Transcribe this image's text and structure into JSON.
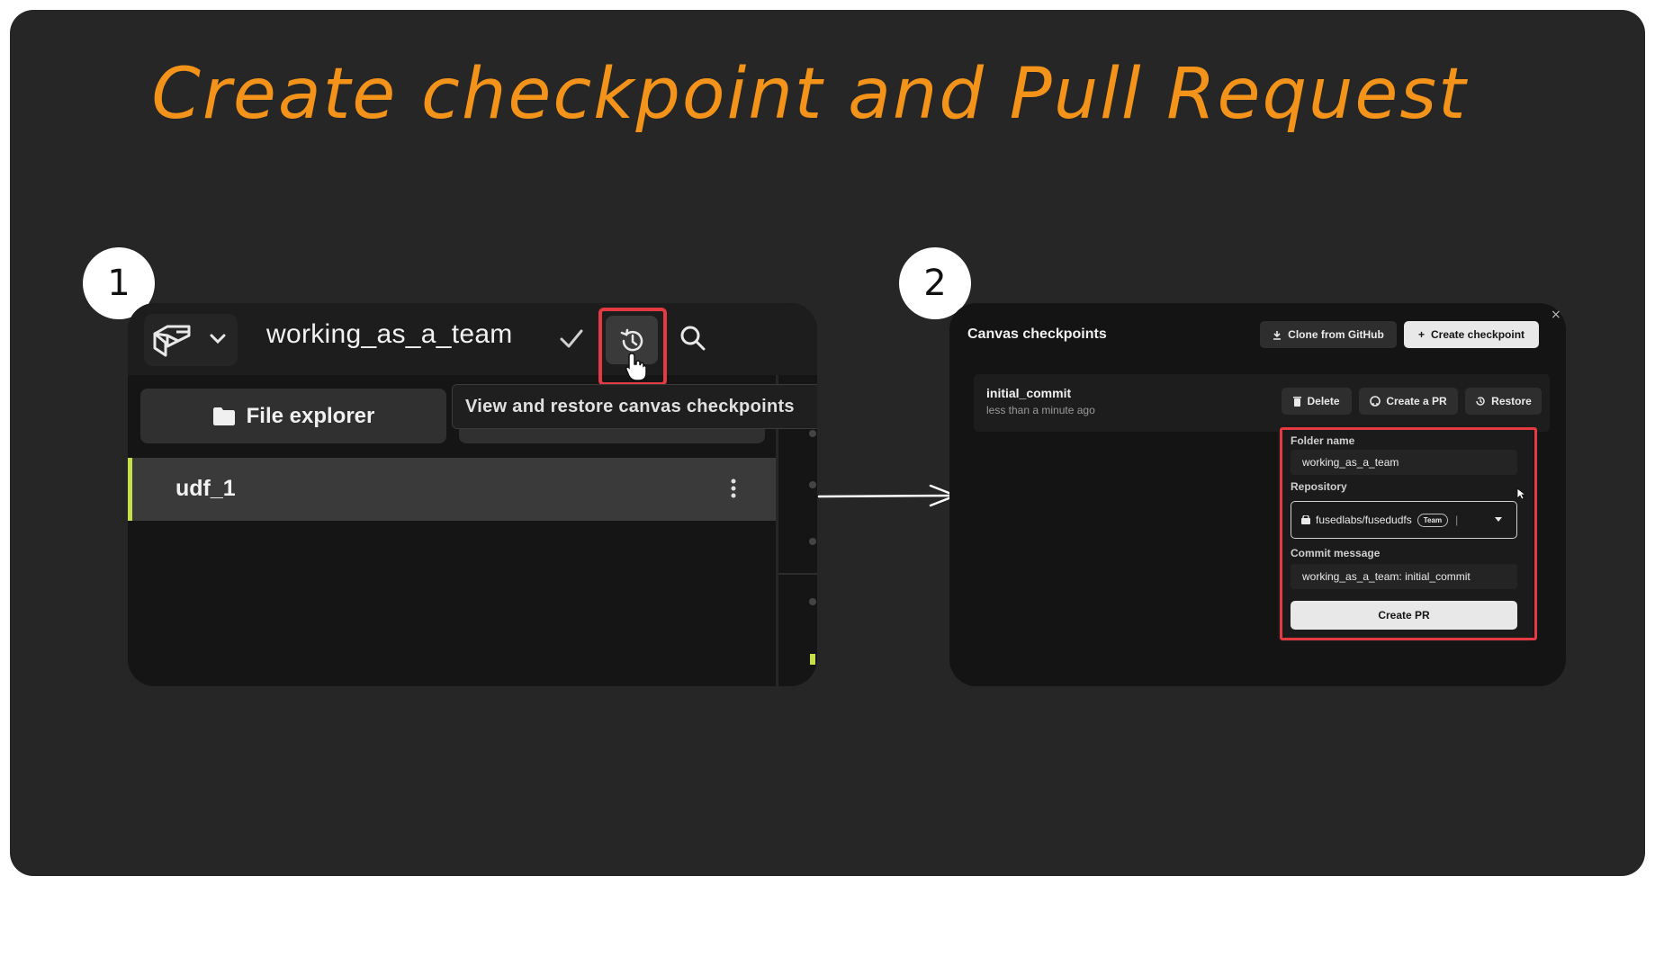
{
  "headline": "Create checkpoint and Pull Request",
  "steps": {
    "one": "1",
    "two": "2"
  },
  "panel1": {
    "canvas_title": "working_as_a_team",
    "file_explorer_label": "File explorer",
    "tooltip": "View and restore canvas checkpoints",
    "udf_name": "udf_1",
    "icons": [
      "fused-logo-icon",
      "chevron-down-icon",
      "check-icon",
      "history-icon",
      "pointer-cursor-icon",
      "search-icon",
      "folder-icon",
      "kebab-menu-icon"
    ]
  },
  "panel2": {
    "title": "Canvas checkpoints",
    "clone_label": "Clone from GitHub",
    "create_checkpoint_label": "Create checkpoint",
    "close": "×",
    "checkpoint": {
      "name": "initial_commit",
      "time": "less than a minute ago",
      "delete_label": "Delete",
      "create_pr_label": "Create a PR",
      "restore_label": "Restore"
    },
    "pr_form": {
      "folder_label": "Folder name",
      "folder_value": "working_as_a_team",
      "repo_label": "Repository",
      "repo_value": "fusedlabs/fusedudfs",
      "repo_badge": "Team",
      "commit_label": "Commit message",
      "commit_value": "working_as_a_team: initial_commit",
      "submit_label": "Create PR"
    }
  },
  "colors": {
    "headline": "#f3931a",
    "card_bg": "#262626",
    "highlight": "#e53a41",
    "selected_accent": "#c6e04a"
  }
}
